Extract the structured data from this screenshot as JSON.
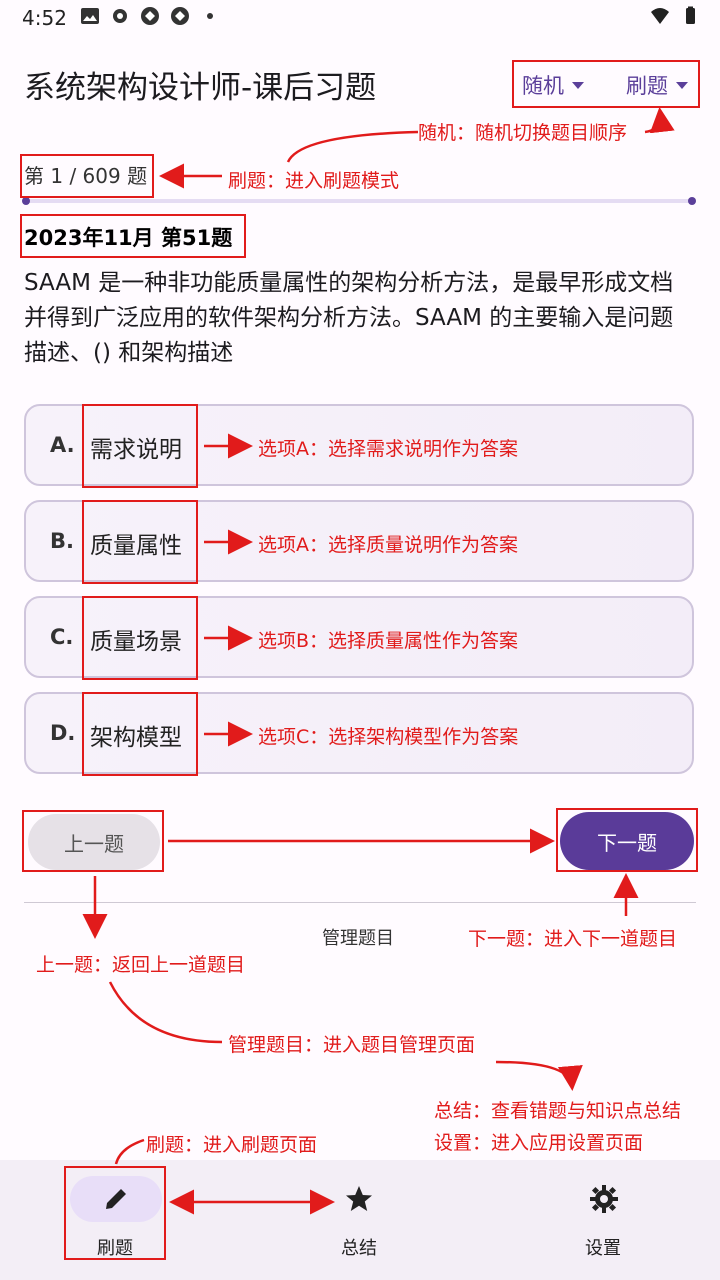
{
  "status_bar": {
    "time": "4:52"
  },
  "app_bar": {
    "title": "系统架构设计师-课后习题",
    "menu_random": "随机",
    "menu_practice": "刷题"
  },
  "progress": {
    "label": "第 1 / 609 题",
    "fraction": 0.0016
  },
  "question": {
    "source": "2023年11月 第51题",
    "text": "SAAM 是一种非功能质量属性的架构分析方法，是最早形成文档并得到广泛应用的软件架构分析方法。SAAM 的主要输入是问题描述、() 和架构描述"
  },
  "options": [
    {
      "letter": "A.",
      "text": "需求说明"
    },
    {
      "letter": "B.",
      "text": "质量属性"
    },
    {
      "letter": "C.",
      "text": "质量场景"
    },
    {
      "letter": "D.",
      "text": "架构模型"
    }
  ],
  "buttons": {
    "prev": "上一题",
    "next": "下一题",
    "manage": "管理题目"
  },
  "bottom_nav": [
    {
      "label": "刷题",
      "icon": "pencil-icon"
    },
    {
      "label": "总结",
      "icon": "star-icon"
    },
    {
      "label": "设置",
      "icon": "gear-icon"
    }
  ],
  "annotations": {
    "random": "随机：随机切换题目顺序",
    "practice_mode": "刷题：进入刷题模式",
    "opt_a": "选项A：选择需求说明作为答案",
    "opt_b": "选项A：选择质量说明作为答案",
    "opt_c": "选项B：选择质量属性作为答案",
    "opt_d": "选项C：选择架构模型作为答案",
    "next": "下一题：进入下一道题目",
    "prev": "上一题：返回上一道题目",
    "manage": "管理题目：进入题目管理页面",
    "summary": "总结：查看错题与知识点总结",
    "settings": "设置：进入应用设置页面",
    "practice_page": "刷题：进入刷题页面"
  },
  "colors": {
    "accent": "#5a3b99",
    "annotation": "#e11b1b",
    "background": "#fffbff"
  }
}
